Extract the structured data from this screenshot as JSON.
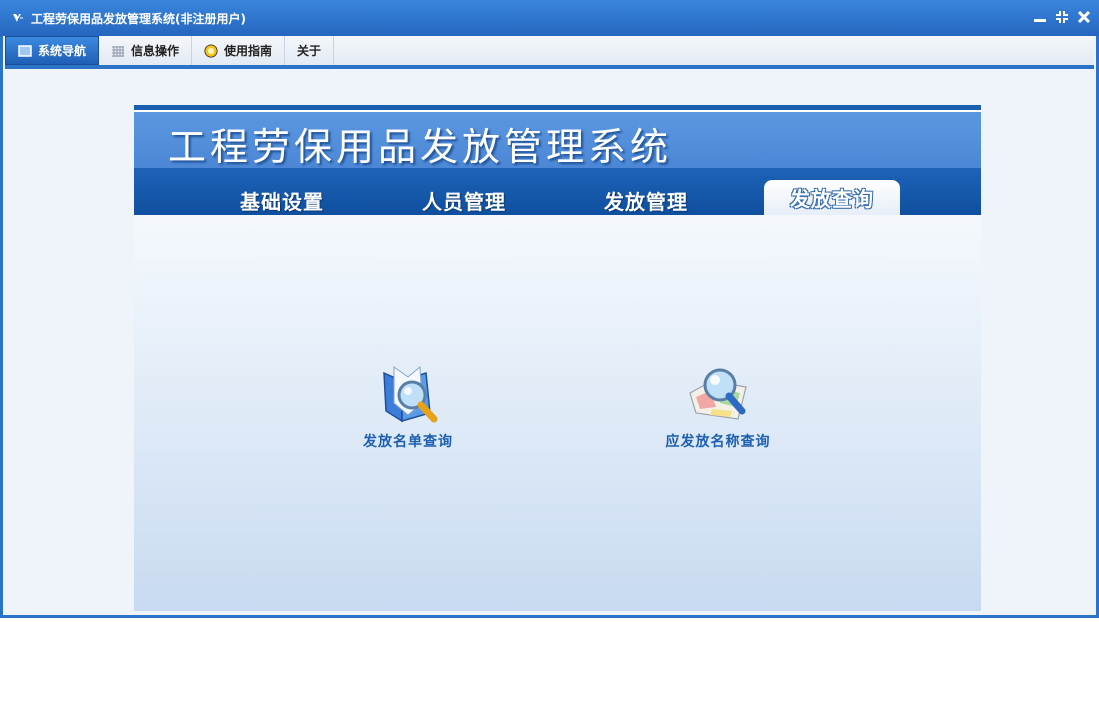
{
  "window": {
    "title": "工程劳保用品发放管理系统(非注册用户)"
  },
  "menubar": {
    "tabs": [
      {
        "label": "系统导航",
        "icon": "monitor-icon",
        "active": true
      },
      {
        "label": "信息操作",
        "icon": "grid-icon",
        "active": false
      },
      {
        "label": "使用指南",
        "icon": "help-icon",
        "active": false
      },
      {
        "label": "关于",
        "icon": "",
        "active": false
      }
    ]
  },
  "panel": {
    "banner_title": "工程劳保用品发放管理系统",
    "nav": [
      {
        "label": "基础设置",
        "active": false
      },
      {
        "label": "人员管理",
        "active": false
      },
      {
        "label": "发放管理",
        "active": false
      },
      {
        "label": "发放查询",
        "active": true
      }
    ],
    "features": [
      {
        "label": "发放名单查询",
        "icon": "book-search-icon"
      },
      {
        "label": "应发放名称查询",
        "icon": "map-search-icon"
      }
    ]
  },
  "colors": {
    "title_bar": "#2a73c8",
    "nav_bar": "#1a5eb0",
    "banner": "#5b97e0",
    "feature_text": "#1c5fb1"
  }
}
